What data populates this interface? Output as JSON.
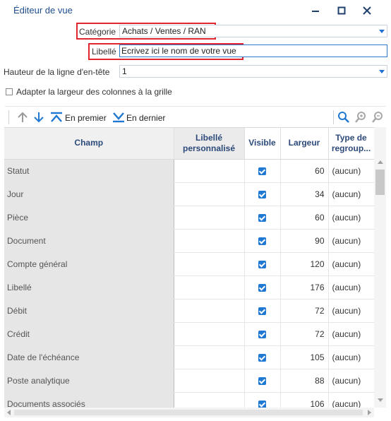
{
  "window": {
    "title": "Éditeur de vue"
  },
  "form": {
    "categorie_label": "Catégorie",
    "categorie_value": "Achats / Ventes / RAN",
    "libelle_label": "Libellé",
    "libelle_value": "Ecrivez ici le nom de votre vue",
    "hauteur_label": "Hauteur de la ligne d'en-tête",
    "hauteur_value": "1",
    "adapter_label": "Adapter la largeur des colonnes à la grille",
    "adapter_checked": false
  },
  "toolbar": {
    "move_up_icon": "arrow-up-icon",
    "move_down_icon": "arrow-down-icon",
    "first_label": "En premier",
    "last_label": "En dernier",
    "search_icon": "search-icon",
    "zoom_in_icon": "zoom-in-icon",
    "zoom_out_icon": "zoom-out-icon"
  },
  "grid": {
    "headers": {
      "champ": "Champ",
      "libelle_line1": "Libellé",
      "libelle_line2": "personnalisé",
      "visible": "Visible",
      "largeur": "Largeur",
      "type_line1": "Type de",
      "type_line2": "regroup..."
    },
    "rows": [
      {
        "champ": "Statut",
        "libelle": "",
        "visible": true,
        "largeur": "60",
        "type": "(aucun)"
      },
      {
        "champ": "Jour",
        "libelle": "",
        "visible": true,
        "largeur": "34",
        "type": "(aucun)"
      },
      {
        "champ": "Pièce",
        "libelle": "",
        "visible": true,
        "largeur": "60",
        "type": "(aucun)"
      },
      {
        "champ": "Document",
        "libelle": "",
        "visible": true,
        "largeur": "90",
        "type": "(aucun)"
      },
      {
        "champ": "Compte général",
        "libelle": "",
        "visible": true,
        "largeur": "120",
        "type": "(aucun)"
      },
      {
        "champ": "Libellé",
        "libelle": "",
        "visible": true,
        "largeur": "176",
        "type": "(aucun)"
      },
      {
        "champ": "Débit",
        "libelle": "",
        "visible": true,
        "largeur": "72",
        "type": "(aucun)"
      },
      {
        "champ": "Crédit",
        "libelle": "",
        "visible": true,
        "largeur": "72",
        "type": "(aucun)"
      },
      {
        "champ": "Date de l'échéance",
        "libelle": "",
        "visible": true,
        "largeur": "105",
        "type": "(aucun)"
      },
      {
        "champ": "Poste analytique",
        "libelle": "",
        "visible": true,
        "largeur": "88",
        "type": "(aucun)"
      },
      {
        "champ": "Documents associés",
        "libelle": "",
        "visible": true,
        "largeur": "106",
        "type": "(aucun)"
      }
    ]
  },
  "colors": {
    "accent": "#1f78d1",
    "highlight": "#e1262d",
    "header_text": "#2c4a7a"
  }
}
